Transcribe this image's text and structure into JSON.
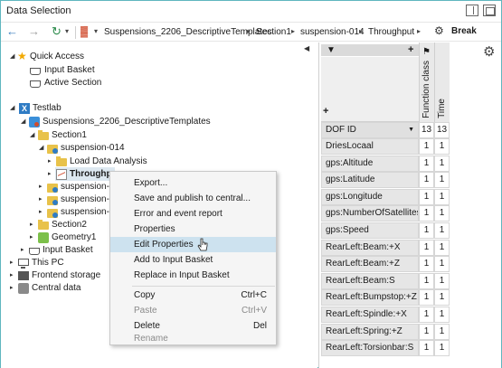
{
  "window": {
    "title": "Data Selection"
  },
  "toolbar": {
    "breadcrumbs": [
      "Suspensions_2206_DescriptiveTemplates",
      "Section1",
      "suspension-014",
      "Throughput"
    ],
    "break_label": "Break"
  },
  "tree": {
    "quick_access": "Quick Access",
    "input_basket_qa": "Input Basket",
    "active_section": "Active Section",
    "testlab": "Testlab",
    "project": "Suspensions_2206_DescriptiveTemplates",
    "section1": "Section1",
    "suspension014": "suspension-014",
    "load_data_analysis": "Load Data Analysis",
    "throughput": "Throughpu",
    "susp_a": "suspension-0",
    "susp_b": "suspension-0",
    "susp_c": "suspension-0",
    "section2": "Section2",
    "geometry1": "Geometry1",
    "input_basket": "Input Basket",
    "this_pc": "This PC",
    "frontend_storage": "Frontend storage",
    "central_data": "Central data"
  },
  "context_menu": {
    "items": [
      {
        "label": "Export...",
        "shortcut": ""
      },
      {
        "label": "Save and publish to central...",
        "shortcut": ""
      },
      {
        "label": "Error and event report",
        "shortcut": ""
      },
      {
        "label": "Properties",
        "shortcut": ""
      },
      {
        "label": "Edit Properties",
        "shortcut": ""
      },
      {
        "label": "Add to Input Basket",
        "shortcut": ""
      },
      {
        "label": "Replace in Input Basket",
        "shortcut": ""
      },
      {
        "label": "Copy",
        "shortcut": "Ctrl+C"
      },
      {
        "label": "Paste",
        "shortcut": "Ctrl+V"
      },
      {
        "label": "Delete",
        "shortcut": "Del"
      },
      {
        "label": "Rename",
        "shortcut": ""
      }
    ]
  },
  "grid": {
    "columns": [
      "Function class",
      "Time"
    ],
    "header_label": "DOF ID",
    "header_counts": [
      "13",
      "13"
    ],
    "rows": [
      {
        "name": "DriesLocaal",
        "a": "1",
        "b": "1"
      },
      {
        "name": "gps:Altitude",
        "a": "1",
        "b": "1"
      },
      {
        "name": "gps:Latitude",
        "a": "1",
        "b": "1"
      },
      {
        "name": "gps:Longitude",
        "a": "1",
        "b": "1"
      },
      {
        "name": "gps:NumberOfSatellites",
        "a": "1",
        "b": "1"
      },
      {
        "name": "gps:Speed",
        "a": "1",
        "b": "1"
      },
      {
        "name": "RearLeft:Beam:+X",
        "a": "1",
        "b": "1"
      },
      {
        "name": "RearLeft:Beam:+Z",
        "a": "1",
        "b": "1"
      },
      {
        "name": "RearLeft:Beam:S",
        "a": "1",
        "b": "1"
      },
      {
        "name": "RearLeft:Bumpstop:+Z",
        "a": "1",
        "b": "1"
      },
      {
        "name": "RearLeft:Spindle:+X",
        "a": "1",
        "b": "1"
      },
      {
        "name": "RearLeft:Spring:+Z",
        "a": "1",
        "b": "1"
      },
      {
        "name": "RearLeft:Torsionbar:S",
        "a": "1",
        "b": "1"
      }
    ]
  }
}
